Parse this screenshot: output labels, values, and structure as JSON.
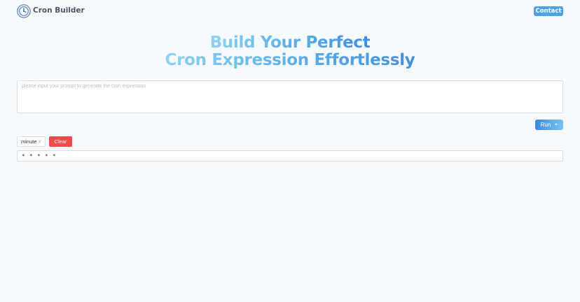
{
  "header": {
    "app_title": "Cron Builder",
    "logo_icon": "clock-logo-icon",
    "contact_label": "Contact"
  },
  "hero": {
    "line1": "Build Your Perfect",
    "line2": "Cron Expression Effortlessly"
  },
  "prompt": {
    "value": "",
    "placeholder": "please input your prompt to generate the cron expression"
  },
  "run": {
    "label": "Run",
    "icon": "sparkle-icon"
  },
  "controls": {
    "unit_selected": "minute",
    "clear_label": "Clear"
  },
  "output": {
    "expression": "* * * * *"
  },
  "colors": {
    "background": "#f7fafd",
    "accent": "#4ea3e8",
    "danger": "#f5484b",
    "hero_gradient_start": "#8fd3f0",
    "hero_gradient_end": "#3f8fe0"
  }
}
